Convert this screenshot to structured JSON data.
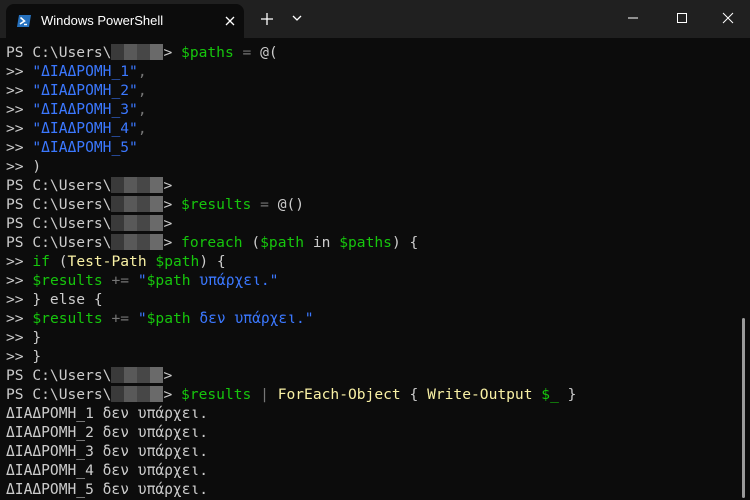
{
  "window": {
    "tab_title": "Windows PowerShell",
    "tab_icon": "powershell-icon"
  },
  "colors": {
    "background": "#0c0c0c",
    "titlebar": "#202020",
    "text": "#cccccc",
    "variable": "#16c60c",
    "string": "#3b78ff",
    "command": "#f9f1a5",
    "operator": "#767676",
    "prompt_redaction": "#555555"
  },
  "terminal": {
    "prompt_prefix": "PS C:\\Users\\",
    "prompt_suffix": ">",
    "continuation": ">>",
    "lines": [
      {
        "kind": "prompt",
        "segments": [
          {
            "text": " ",
            "style": "plain"
          },
          {
            "text": "$paths",
            "style": "var"
          },
          {
            "text": " = ",
            "style": "op"
          },
          {
            "text": "@(",
            "style": "plain"
          }
        ]
      },
      {
        "kind": "cont",
        "segments": [
          {
            "text": " \"ΔΙΑΔΡΟΜΗ_1\"",
            "style": "str"
          },
          {
            "text": ",",
            "style": "op"
          }
        ]
      },
      {
        "kind": "cont",
        "segments": [
          {
            "text": " \"ΔΙΑΔΡΟΜΗ_2\"",
            "style": "str"
          },
          {
            "text": ",",
            "style": "op"
          }
        ]
      },
      {
        "kind": "cont",
        "segments": [
          {
            "text": " \"ΔΙΑΔΡΟΜΗ_3\"",
            "style": "str"
          },
          {
            "text": ",",
            "style": "op"
          }
        ]
      },
      {
        "kind": "cont",
        "segments": [
          {
            "text": " \"ΔΙΑΔΡΟΜΗ_4\"",
            "style": "str"
          },
          {
            "text": ",",
            "style": "op"
          }
        ]
      },
      {
        "kind": "cont",
        "segments": [
          {
            "text": " \"ΔΙΑΔΡΟΜΗ_5\"",
            "style": "str"
          }
        ]
      },
      {
        "kind": "cont",
        "segments": [
          {
            "text": " )",
            "style": "plain"
          }
        ]
      },
      {
        "kind": "prompt",
        "segments": []
      },
      {
        "kind": "prompt",
        "segments": [
          {
            "text": " ",
            "style": "plain"
          },
          {
            "text": "$results",
            "style": "var"
          },
          {
            "text": " = ",
            "style": "op"
          },
          {
            "text": "@()",
            "style": "plain"
          }
        ]
      },
      {
        "kind": "prompt",
        "segments": []
      },
      {
        "kind": "prompt",
        "segments": [
          {
            "text": " ",
            "style": "plain"
          },
          {
            "text": "foreach",
            "style": "kw"
          },
          {
            "text": " (",
            "style": "plain"
          },
          {
            "text": "$path",
            "style": "var"
          },
          {
            "text": " in ",
            "style": "plain"
          },
          {
            "text": "$paths",
            "style": "var"
          },
          {
            "text": ") {",
            "style": "plain"
          }
        ]
      },
      {
        "kind": "cont",
        "segments": [
          {
            "text": " ",
            "style": "plain"
          },
          {
            "text": "if",
            "style": "kw"
          },
          {
            "text": " (",
            "style": "plain"
          },
          {
            "text": "Test-Path",
            "style": "cmd"
          },
          {
            "text": " ",
            "style": "plain"
          },
          {
            "text": "$path",
            "style": "var"
          },
          {
            "text": ") {",
            "style": "plain"
          }
        ]
      },
      {
        "kind": "cont",
        "segments": [
          {
            "text": " ",
            "style": "plain"
          },
          {
            "text": "$results",
            "style": "var"
          },
          {
            "text": " += ",
            "style": "op"
          },
          {
            "text": "\"",
            "style": "str"
          },
          {
            "text": "$path",
            "style": "var"
          },
          {
            "text": " υπάρχει.\"",
            "style": "str"
          }
        ]
      },
      {
        "kind": "cont",
        "segments": [
          {
            "text": " } else {",
            "style": "plain"
          }
        ]
      },
      {
        "kind": "cont",
        "segments": [
          {
            "text": " ",
            "style": "plain"
          },
          {
            "text": "$results",
            "style": "var"
          },
          {
            "text": " += ",
            "style": "op"
          },
          {
            "text": "\"",
            "style": "str"
          },
          {
            "text": "$path",
            "style": "var"
          },
          {
            "text": " δεν υπάρχει.\"",
            "style": "str"
          }
        ]
      },
      {
        "kind": "cont",
        "segments": [
          {
            "text": " }",
            "style": "plain"
          }
        ]
      },
      {
        "kind": "cont",
        "segments": [
          {
            "text": " }",
            "style": "plain"
          }
        ]
      },
      {
        "kind": "prompt",
        "segments": []
      },
      {
        "kind": "prompt",
        "segments": [
          {
            "text": " ",
            "style": "plain"
          },
          {
            "text": "$results",
            "style": "var"
          },
          {
            "text": " | ",
            "style": "op"
          },
          {
            "text": "ForEach-Object",
            "style": "cmd"
          },
          {
            "text": " { ",
            "style": "plain"
          },
          {
            "text": "Write-Output",
            "style": "cmd"
          },
          {
            "text": " ",
            "style": "plain"
          },
          {
            "text": "$_",
            "style": "var"
          },
          {
            "text": " }",
            "style": "plain"
          }
        ]
      },
      {
        "kind": "output",
        "segments": [
          {
            "text": "ΔΙΑΔΡΟΜΗ_1 δεν υπάρχει.",
            "style": "plain"
          }
        ]
      },
      {
        "kind": "output",
        "segments": [
          {
            "text": "ΔΙΑΔΡΟΜΗ_2 δεν υπάρχει.",
            "style": "plain"
          }
        ]
      },
      {
        "kind": "output",
        "segments": [
          {
            "text": "ΔΙΑΔΡΟΜΗ_3 δεν υπάρχει.",
            "style": "plain"
          }
        ]
      },
      {
        "kind": "output",
        "segments": [
          {
            "text": "ΔΙΑΔΡΟΜΗ_4 δεν υπάρχει.",
            "style": "plain"
          }
        ]
      },
      {
        "kind": "output",
        "segments": [
          {
            "text": "ΔΙΑΔΡΟΜΗ_5 δεν υπάρχει.",
            "style": "plain"
          }
        ]
      }
    ]
  }
}
